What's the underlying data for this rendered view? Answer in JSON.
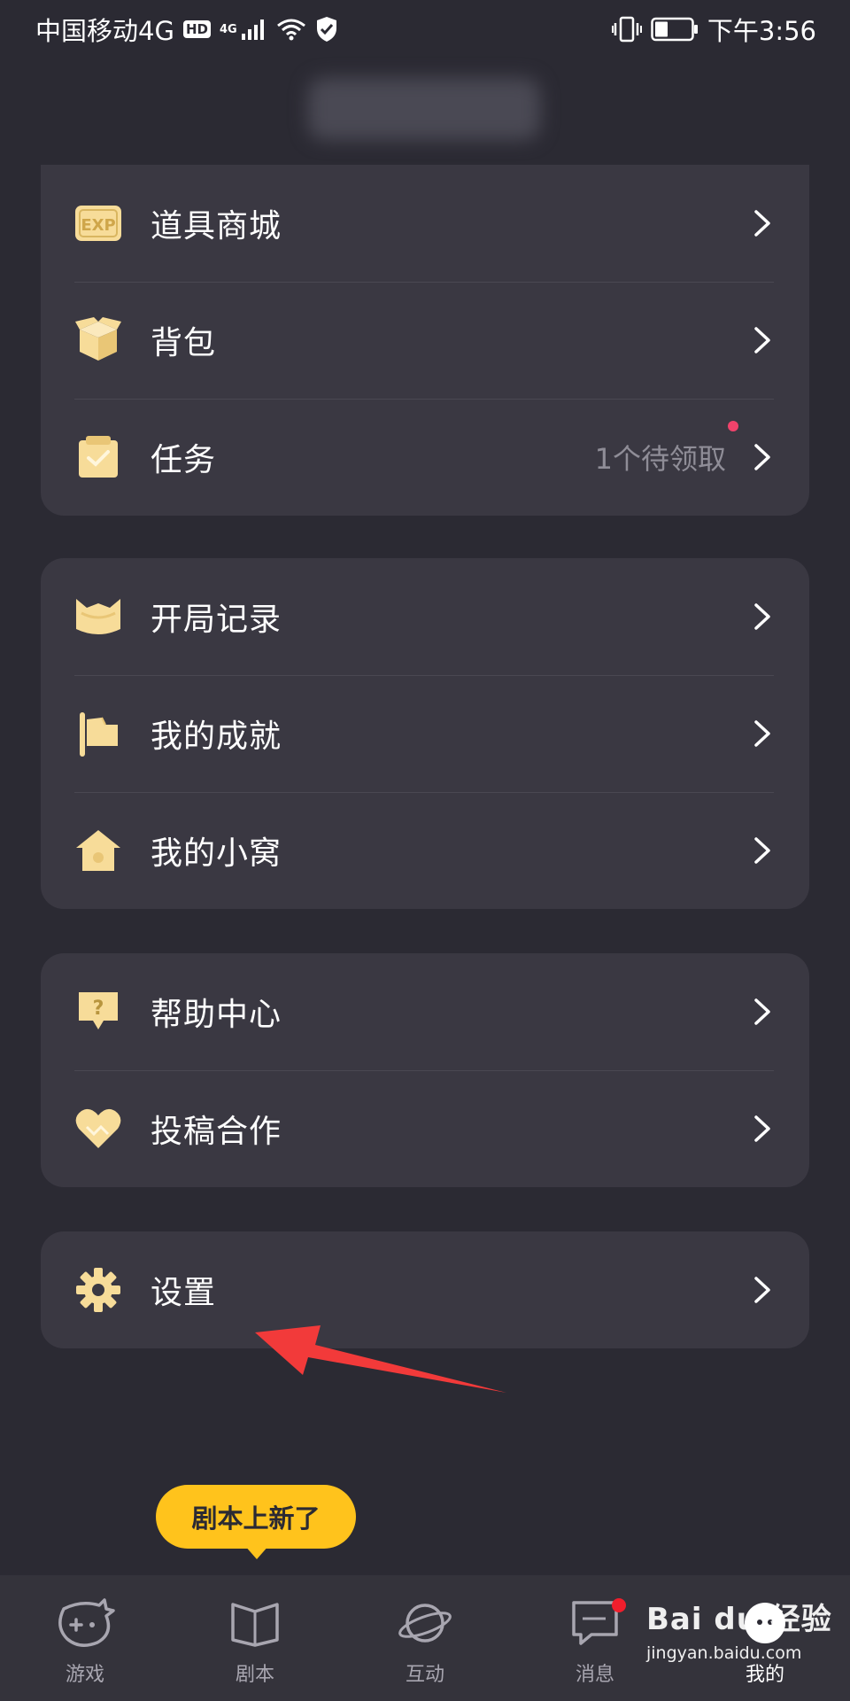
{
  "status_bar": {
    "carrier": "中国移动4G",
    "hd": "HD",
    "signal_tag": "4G",
    "time": "下午3:56",
    "icons": [
      "hd-icon",
      "signal-icon",
      "wifi-icon",
      "shield-icon",
      "vibrate-icon",
      "battery-icon"
    ]
  },
  "menu": {
    "shop_label": "道具商城",
    "bag_label": "背包",
    "task_label": "任务",
    "task_extra": "1个待领取",
    "record_label": "开局记录",
    "achievement_label": "我的成就",
    "nest_label": "我的小窝",
    "help_label": "帮助中心",
    "contribute_label": "投稿合作",
    "settings_label": "设置"
  },
  "tooltip": {
    "text": "剧本上新了"
  },
  "bottom_nav": {
    "games": "游戏",
    "scripts": "剧本",
    "interact": "互动",
    "messages": "消息",
    "mine": "我的"
  },
  "watermark": {
    "brand": "Bai du 经验",
    "url": "jingyan.baidu.com"
  },
  "colors": {
    "background": "#2b2a33",
    "card": "#3a3842",
    "icon_accent": "#f7dc99",
    "tooltip": "#ffc31c",
    "badge_red": "#f0436b",
    "annotation_arrow": "#f23a3a"
  }
}
